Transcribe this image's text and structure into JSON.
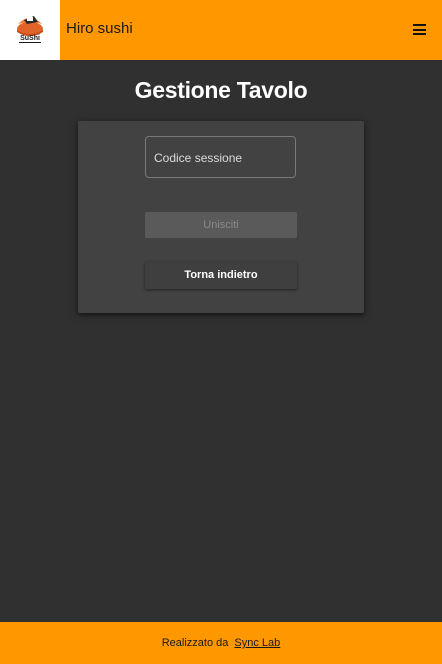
{
  "header": {
    "app_title": "Hiro sushi",
    "logo_text": "SuShi",
    "menu_icon": "menu-icon"
  },
  "main": {
    "title": "Gestione Tavolo",
    "session_input": {
      "label": "Codice sessione",
      "value": ""
    },
    "join_button_label": "Unisciti",
    "back_button_label": "Torna indietro"
  },
  "footer": {
    "text": "Realizzato da",
    "link_text": "Sync Lab"
  },
  "colors": {
    "accent": "#ff9800",
    "background": "#303030",
    "card": "#424242"
  }
}
